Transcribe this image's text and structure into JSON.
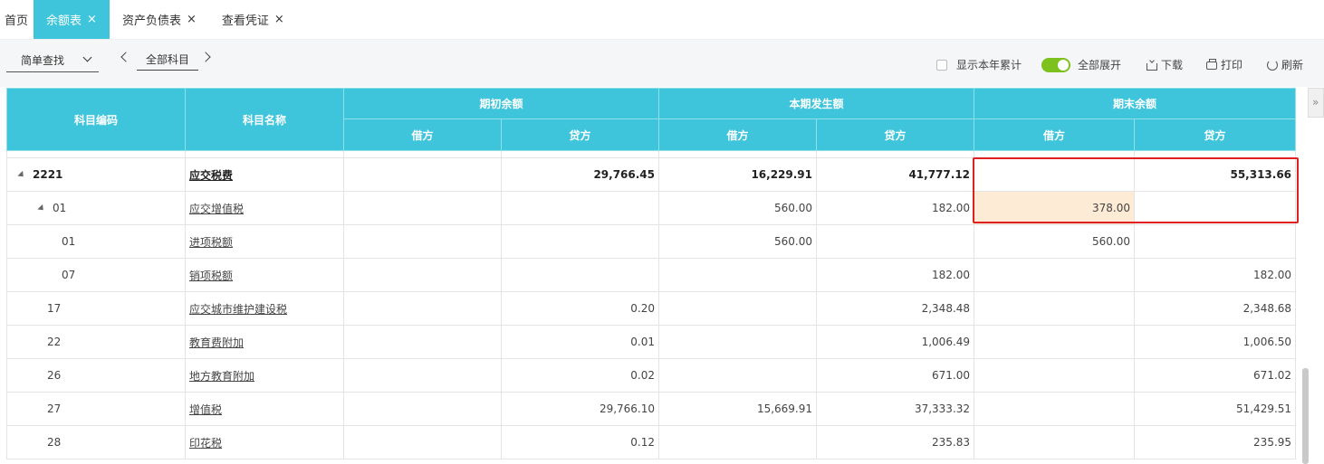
{
  "tabs": [
    {
      "label": "首页",
      "closable": false,
      "active": false
    },
    {
      "label": "余额表",
      "closable": true,
      "active": true
    },
    {
      "label": "资产负债表",
      "closable": true,
      "active": false
    },
    {
      "label": "查看凭证",
      "closable": true,
      "active": false
    }
  ],
  "close_glyph": "×",
  "toolbar": {
    "search_mode": "简单查找",
    "subject_filter": "全部科目",
    "ytd_label": "显示本年累计",
    "expand_all_label": "全部展开",
    "download_label": "下载",
    "print_label": "打印",
    "refresh_label": "刷新",
    "expand_all_on": true,
    "ytd_checked": false
  },
  "table": {
    "headers": {
      "code": "科目编码",
      "name": "科目名称",
      "opening": "期初余额",
      "current": "本期发生额",
      "closing": "期末余额",
      "debit": "借方",
      "credit": "贷方"
    },
    "rows": [
      {
        "code": "2221",
        "name": "应交税费",
        "ob_debit": "",
        "ob_credit": "29,766.45",
        "cur_debit": "16,229.91",
        "cur_credit": "41,777.12",
        "cb_debit": "",
        "cb_credit": "55,313.66",
        "bold": true,
        "expander": true
      },
      {
        "code": "01",
        "name": "应交增值税",
        "ob_debit": "",
        "ob_credit": "",
        "cur_debit": "560.00",
        "cur_credit": "182.00",
        "cb_debit": "378.00",
        "cb_credit": "",
        "expander": true
      },
      {
        "code": "01",
        "name": "进项税额",
        "ob_debit": "",
        "ob_credit": "",
        "cur_debit": "560.00",
        "cur_credit": "",
        "cb_debit": "560.00",
        "cb_credit": ""
      },
      {
        "code": "07",
        "name": "销项税额",
        "ob_debit": "",
        "ob_credit": "",
        "cur_debit": "",
        "cur_credit": "182.00",
        "cb_debit": "",
        "cb_credit": "182.00"
      },
      {
        "code": "17",
        "name": "应交城市维护建设税",
        "ob_debit": "",
        "ob_credit": "0.20",
        "cur_debit": "",
        "cur_credit": "2,348.48",
        "cb_debit": "",
        "cb_credit": "2,348.68"
      },
      {
        "code": "22",
        "name": "教育费附加",
        "ob_debit": "",
        "ob_credit": "0.01",
        "cur_debit": "",
        "cur_credit": "1,006.49",
        "cb_debit": "",
        "cb_credit": "1,006.50"
      },
      {
        "code": "26",
        "name": "地方教育附加",
        "ob_debit": "",
        "ob_credit": "0.02",
        "cur_debit": "",
        "cur_credit": "671.00",
        "cb_debit": "",
        "cb_credit": "671.02"
      },
      {
        "code": "27",
        "name": "增值税",
        "ob_debit": "",
        "ob_credit": "29,766.10",
        "cur_debit": "15,669.91",
        "cur_credit": "37,333.32",
        "cb_debit": "",
        "cb_credit": "51,429.51"
      },
      {
        "code": "28",
        "name": "印花税",
        "ob_debit": "",
        "ob_credit": "0.12",
        "cur_debit": "",
        "cur_credit": "235.83",
        "cb_debit": "",
        "cb_credit": "235.95"
      }
    ]
  },
  "side_panel_glyph": "»",
  "colors": {
    "header_bg": "#3ec5dc",
    "highlight": "#fdebd5",
    "annotation_border": "#e02020",
    "switch_on": "#7cc11e"
  }
}
